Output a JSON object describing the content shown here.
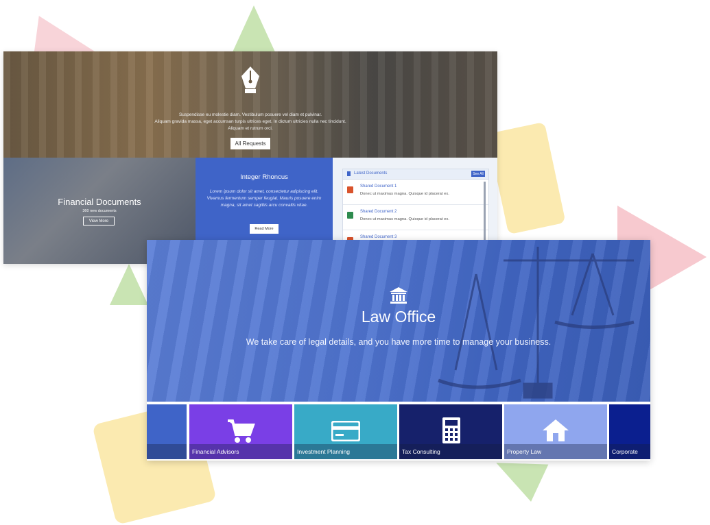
{
  "colors": {
    "accent_blue": "#3f64c8",
    "financial_advisors": "#7a3fe6",
    "investment_planning": "#38aac7",
    "tax_consulting": "#16216b",
    "property_law": "#8fa6ee",
    "corporate": "#0b1f8f"
  },
  "back_page": {
    "hero": {
      "icon": "fountain-pen-icon",
      "text_lines": [
        "Suspendisse eu molestie diam. Vestibulum posuere vel diam et pulvinar.",
        "Aliquam gravida massa, eget accumsan turpis ultrices eget. In dictum ultricies nulla nec tincidunt.",
        "Aliquam et rutrum orci."
      ],
      "button_label": "All Requests"
    },
    "financial_panel": {
      "title": "Financial Documents",
      "subtitle": "360 new documents",
      "button_label": "View More"
    },
    "integer_panel": {
      "title": "Integer Rhoncus",
      "text": "Lorem ipsum dolor sit amet, consectetur adipiscing elit. Vivamus fermentum semper feugiat. Mauris posuere enim magna, sit amet sagittis arcu convallis vitae.",
      "button_label": "Read More"
    },
    "documents_panel": {
      "title": "Latest Documents",
      "see_all": "See All",
      "items": [
        {
          "name": "Shared Document 1",
          "desc": "Donec ut maximus magna. Quisque id placerat ex.",
          "icon": "powerpoint-file-icon",
          "color": "#d9532c"
        },
        {
          "name": "Shared Document 2",
          "desc": "Donec ut maximus magna. Quisque id placerat ex.",
          "icon": "excel-file-icon",
          "color": "#2e8b4e"
        },
        {
          "name": "Shared Document 3",
          "desc": "",
          "icon": "powerpoint-file-icon",
          "color": "#d9532c"
        }
      ]
    }
  },
  "front_page": {
    "hero": {
      "icon": "bank-icon",
      "title": "Law Office",
      "subtitle": "We take care of legal details, and you have more time to manage your business."
    },
    "tiles": [
      {
        "label": "",
        "icon": "partial-tile-icon"
      },
      {
        "label": "Financial Advisors",
        "icon": "shopping-cart-icon"
      },
      {
        "label": "Investment Planning",
        "icon": "credit-card-icon"
      },
      {
        "label": "Tax Consulting",
        "icon": "calculator-icon"
      },
      {
        "label": "Property Law",
        "icon": "house-icon"
      },
      {
        "label": "Corporate",
        "icon": "partial-icon"
      }
    ]
  }
}
